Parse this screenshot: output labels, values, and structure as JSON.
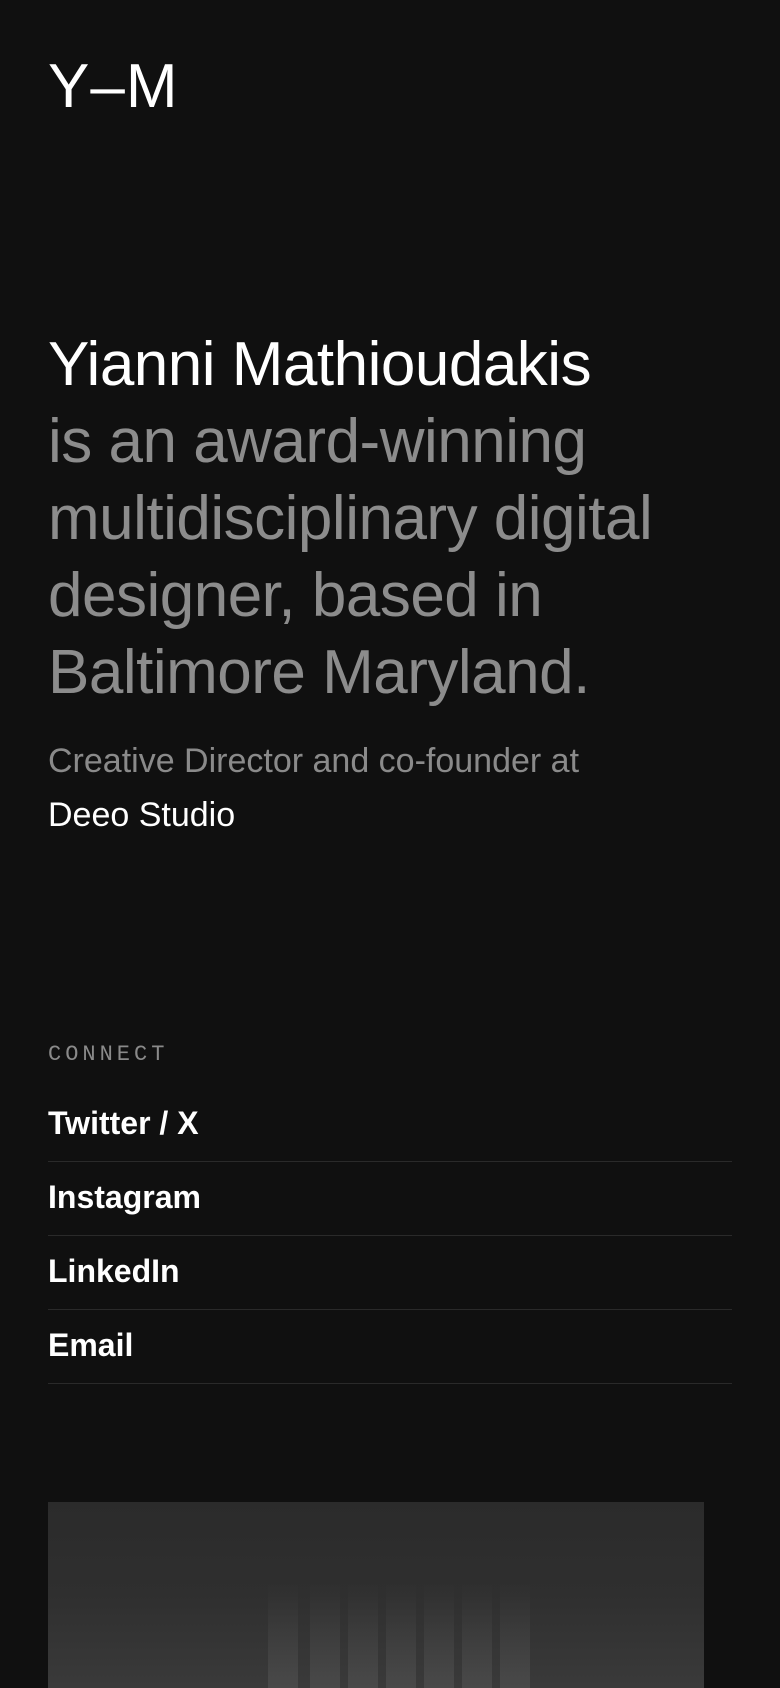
{
  "logo": {
    "text": "Y–M"
  },
  "hero": {
    "name": "Yianni Mathioudakis",
    "description": "is an award-winning multidisciplinary digital designer, based in Baltimore Maryland."
  },
  "role": {
    "text": "Creative Director and co-founder at",
    "studio": "Deeo Studio"
  },
  "connect": {
    "heading": "CONNECT",
    "links": [
      {
        "label": "Twitter / X"
      },
      {
        "label": "Instagram"
      },
      {
        "label": "LinkedIn"
      },
      {
        "label": "Email"
      }
    ]
  },
  "colors": {
    "background": "#101010",
    "text_primary": "#ffffff",
    "text_muted": "#8c8c8c",
    "divider": "#2a2a2a"
  }
}
